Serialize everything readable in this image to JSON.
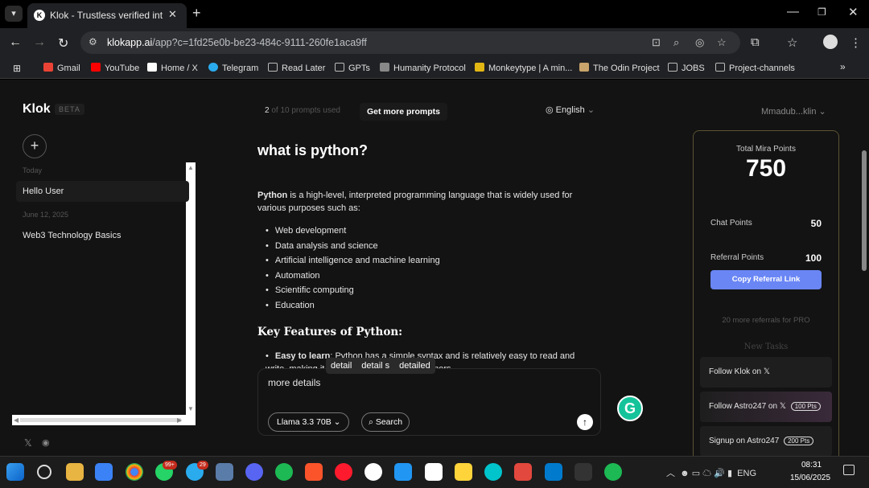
{
  "browser": {
    "tab_title": "Klok - Trustless verified intellige",
    "url_host": "klokapp.ai",
    "url_path": "/app?c=1fd25e0b-be23-484c-9111-260fe1aca9ff",
    "bookmarks": [
      {
        "label": "Gmail",
        "icon": "gmail-icon",
        "color": "#ea4335"
      },
      {
        "label": "YouTube",
        "icon": "youtube-icon",
        "color": "#ff0000"
      },
      {
        "label": "Home / X",
        "icon": "x-icon",
        "color": "#ffffff"
      },
      {
        "label": "Telegram",
        "icon": "telegram-icon",
        "color": "#2aabee"
      },
      {
        "label": "Read Later",
        "icon": "folder-icon",
        "color": "#bbbbbb"
      },
      {
        "label": "GPTs",
        "icon": "folder-icon",
        "color": "#bbbbbb"
      },
      {
        "label": "Humanity Protocol",
        "icon": "humanity-icon",
        "color": "#888888"
      },
      {
        "label": "Monkeytype | A min...",
        "icon": "monkeytype-icon",
        "color": "#e2b714"
      },
      {
        "label": "The Odin Project",
        "icon": "odin-icon",
        "color": "#c9a46b"
      },
      {
        "label": "JOBS",
        "icon": "folder-icon",
        "color": "#bbbbbb"
      },
      {
        "label": "Project-channels",
        "icon": "folder-icon",
        "color": "#bbbbbb"
      }
    ]
  },
  "sidebar": {
    "brand": "Klok",
    "beta": "BETA",
    "groups": [
      {
        "date": "Today",
        "items": [
          "Hello User"
        ]
      },
      {
        "date": "June 12, 2025",
        "items": [
          "Web3 Technology Basics"
        ]
      }
    ]
  },
  "header": {
    "prompts_used": "2",
    "prompts_rest": "of 10 prompts used",
    "get_more": "Get more prompts",
    "language": "English",
    "user": "Mmadub...klin"
  },
  "chat": {
    "question": "what is python?",
    "answer_lead": "Python",
    "answer_rest": " is a high-level, interpreted programming language that is widely used for various purposes such as:",
    "uses": [
      "Web development",
      "Data analysis and science",
      "Artificial intelligence and machine learning",
      "Automation",
      "Scientific computing",
      "Education"
    ],
    "features_heading": "Key Features of Python:",
    "feature_1_title": "Easy to learn",
    "feature_1_text": ": Python has a simple syntax and is relatively easy to read and write, making it an ideal language for beginners."
  },
  "suggestions": [
    "detail",
    "detail s",
    "detailed"
  ],
  "composer": {
    "input_value": "more details",
    "model": "Llama 3.3 70B",
    "search": "Search"
  },
  "points": {
    "total_label": "Total Mira Points",
    "total": "750",
    "chat_label": "Chat Points",
    "chat": "50",
    "referral_label": "Referral Points",
    "referral": "100",
    "copy_referral": "Copy Referral Link",
    "more_referrals": "20 more referrals for PRO",
    "new_tasks": "New Tasks",
    "tasks": [
      {
        "label": "Follow Klok on",
        "badge": ""
      },
      {
        "label": "Follow Astro247 on",
        "badge": "100 Pts"
      },
      {
        "label": "Signup on Astro247",
        "badge": "200 Pts"
      }
    ]
  },
  "taskbar": {
    "badge_whatsapp": "99+",
    "badge_telegram": "29",
    "lang": "ENG",
    "time": "08:31",
    "date": "15/06/2025"
  },
  "colors": {
    "accent": "#6a86f5",
    "card_border": "#5b5232",
    "grammarly": "#15c39a"
  }
}
